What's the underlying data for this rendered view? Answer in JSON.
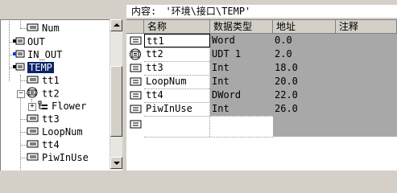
{
  "content_bar": {
    "label": "内容:",
    "path": "'环境\\接口\\TEMP'"
  },
  "tree": {
    "items": [
      {
        "label": "Num"
      },
      {
        "label": "OUT"
      },
      {
        "label": "IN_OUT"
      },
      {
        "label": "TEMP"
      },
      {
        "label": "tt1"
      },
      {
        "label": "tt2"
      },
      {
        "label": "Flower"
      },
      {
        "label": "tt3"
      },
      {
        "label": "LoopNum"
      },
      {
        "label": "tt4"
      },
      {
        "label": "PiwInUse"
      }
    ]
  },
  "table": {
    "headers": {
      "name": "名称",
      "type": "数据类型",
      "address": "地址",
      "comment": "注释"
    },
    "rows": [
      {
        "name": "tt1",
        "type": "Word",
        "address": "0.0"
      },
      {
        "name": "tt2",
        "type": "UDT 1",
        "address": "2.0"
      },
      {
        "name": "tt3",
        "type": "Int",
        "address": "18.0"
      },
      {
        "name": "LoopNum",
        "type": "Int",
        "address": "20.0"
      },
      {
        "name": "tt4",
        "type": "DWord",
        "address": "22.0"
      },
      {
        "name": "PiwInUse",
        "type": "Int",
        "address": "26.0"
      }
    ]
  }
}
